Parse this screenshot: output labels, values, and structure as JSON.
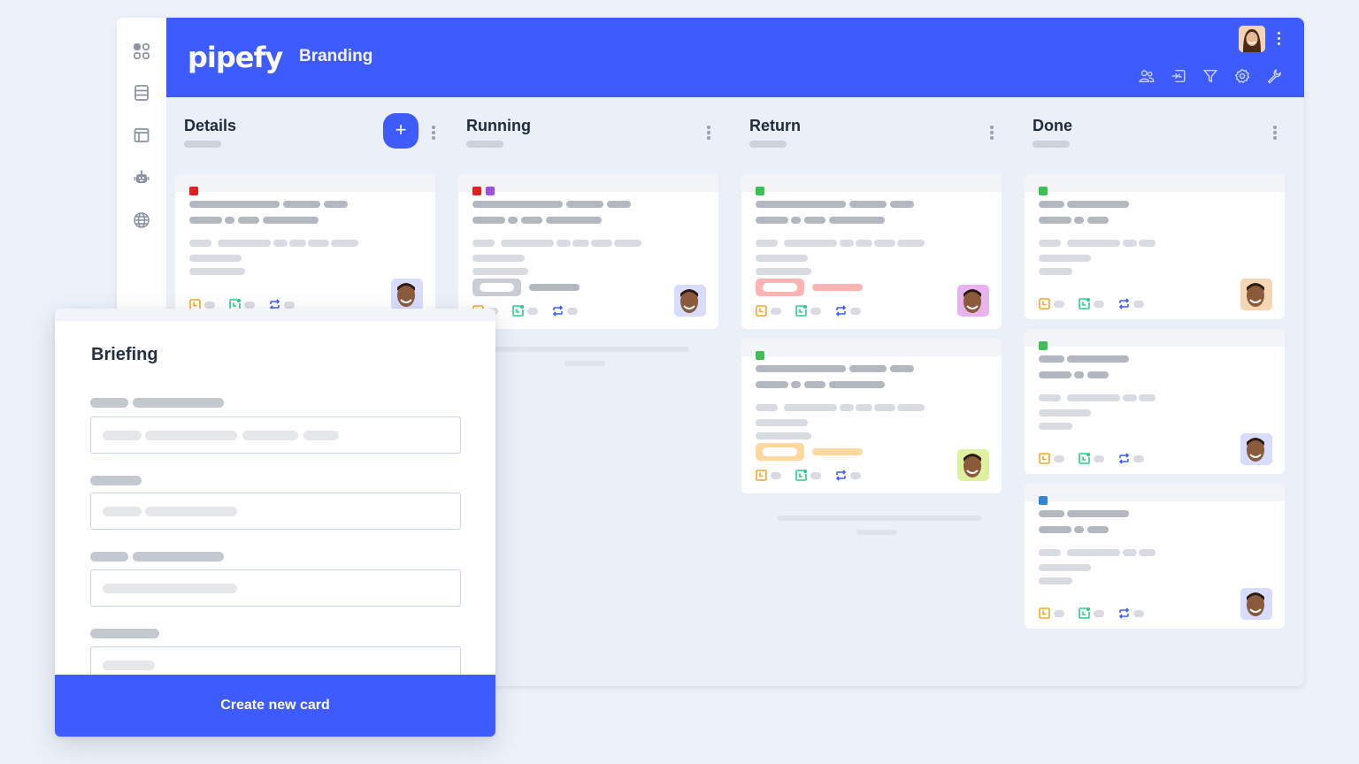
{
  "app": {
    "brand": "pipefy",
    "pipe_name": "Branding",
    "accent_color": "#3e5bfe"
  },
  "sidebar": {
    "items": [
      {
        "icon": "apps-grid-icon"
      },
      {
        "icon": "database-icon"
      },
      {
        "icon": "layout-panel-icon"
      },
      {
        "icon": "robot-icon"
      },
      {
        "icon": "globe-icon"
      }
    ]
  },
  "header": {
    "user_avatar": "user-avatar",
    "tools": [
      {
        "icon": "members-icon"
      },
      {
        "icon": "import-history-icon"
      },
      {
        "icon": "filter-icon"
      },
      {
        "icon": "settings-gear-icon"
      },
      {
        "icon": "wrench-icon"
      }
    ]
  },
  "phases": [
    {
      "title": "Details",
      "add_button": "+",
      "cards": [
        {
          "labels": [
            "#e02020"
          ],
          "avatar_bg": "#d8dcff"
        }
      ]
    },
    {
      "title": "Running",
      "cards": [
        {
          "labels": [
            "#e02020",
            "#a050e0"
          ],
          "avatar_bg": "#d8dcff",
          "tag_color": "#c8ccd4"
        }
      ]
    },
    {
      "title": "Return",
      "cards": [
        {
          "labels": [
            "#3dbf55"
          ],
          "avatar_bg": "#e8b4f0",
          "tag_color": "#ffb3b3"
        },
        {
          "labels": [
            "#3dbf55"
          ],
          "avatar_bg": "#dff0a0",
          "tag_color": "#ffd9a0"
        }
      ]
    },
    {
      "title": "Done",
      "cards": [
        {
          "labels": [
            "#3dbf55"
          ],
          "avatar_bg": "#f5d6b4"
        },
        {
          "labels": [
            "#3dbf55"
          ],
          "avatar_bg": "#d8dcff"
        },
        {
          "labels": [
            "#2f86d8"
          ],
          "avatar_bg": "#d8dcff"
        }
      ]
    }
  ],
  "modal": {
    "title": "Briefing",
    "submit_label": "Create new card"
  },
  "icon_colors": {
    "due": "#f5a623",
    "time": "#2ecc8a",
    "repeat": "#3e5bfe"
  }
}
